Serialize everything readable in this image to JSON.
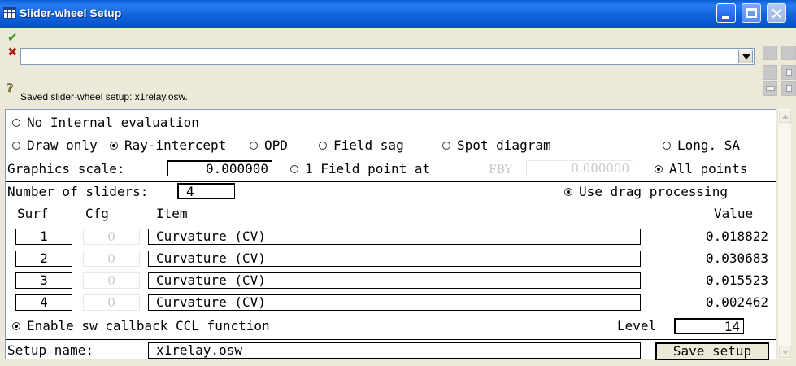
{
  "window": {
    "title": "Slider-wheel Setup",
    "icon": "table-window-icon"
  },
  "toolbar": {
    "accept_icon": "checkmark-icon",
    "cancel_icon": "x-icon",
    "help_icon": "help-question-icon",
    "command_value": "",
    "status": "Saved slider-wheel setup: x1relay.osw."
  },
  "evaluation": {
    "no_internal": "No Internal evaluation",
    "draw_only": "Draw only",
    "ray_intercept": "Ray-intercept",
    "opd": "OPD",
    "field_sag": "Field sag",
    "spot_diagram": "Spot diagram",
    "long_sa": "Long. SA",
    "selected": "Ray-intercept"
  },
  "graphics": {
    "scale_label": "Graphics scale:",
    "scale_value": "0.000000",
    "one_field_label": "1 Field point at",
    "fby_label": "FBY",
    "fby_value": "0.000000",
    "all_points": "All points",
    "selected": "All points"
  },
  "sliders": {
    "count_label": "Number of sliders:",
    "count": "4",
    "drag_label": "Use drag processing",
    "drag_enabled": true
  },
  "table": {
    "headers": {
      "surf": "Surf",
      "cfg": "Cfg",
      "item": "Item",
      "value": "Value"
    },
    "rows": [
      {
        "surf": "1",
        "cfg": "0",
        "item": "Curvature (CV)",
        "value": "0.018822"
      },
      {
        "surf": "2",
        "cfg": "0",
        "item": "Curvature (CV)",
        "value": "0.030683"
      },
      {
        "surf": "3",
        "cfg": "0",
        "item": "Curvature (CV)",
        "value": "0.015523"
      },
      {
        "surf": "4",
        "cfg": "0",
        "item": "Curvature (CV)",
        "value": "0.002462"
      }
    ]
  },
  "callback": {
    "label": "Enable sw_callback CCL function",
    "enabled": true,
    "level_label": "Level",
    "level_value": "14"
  },
  "setup": {
    "name_label": "Setup name:",
    "name_value": "x1relay.osw",
    "save_label": "Save setup"
  }
}
